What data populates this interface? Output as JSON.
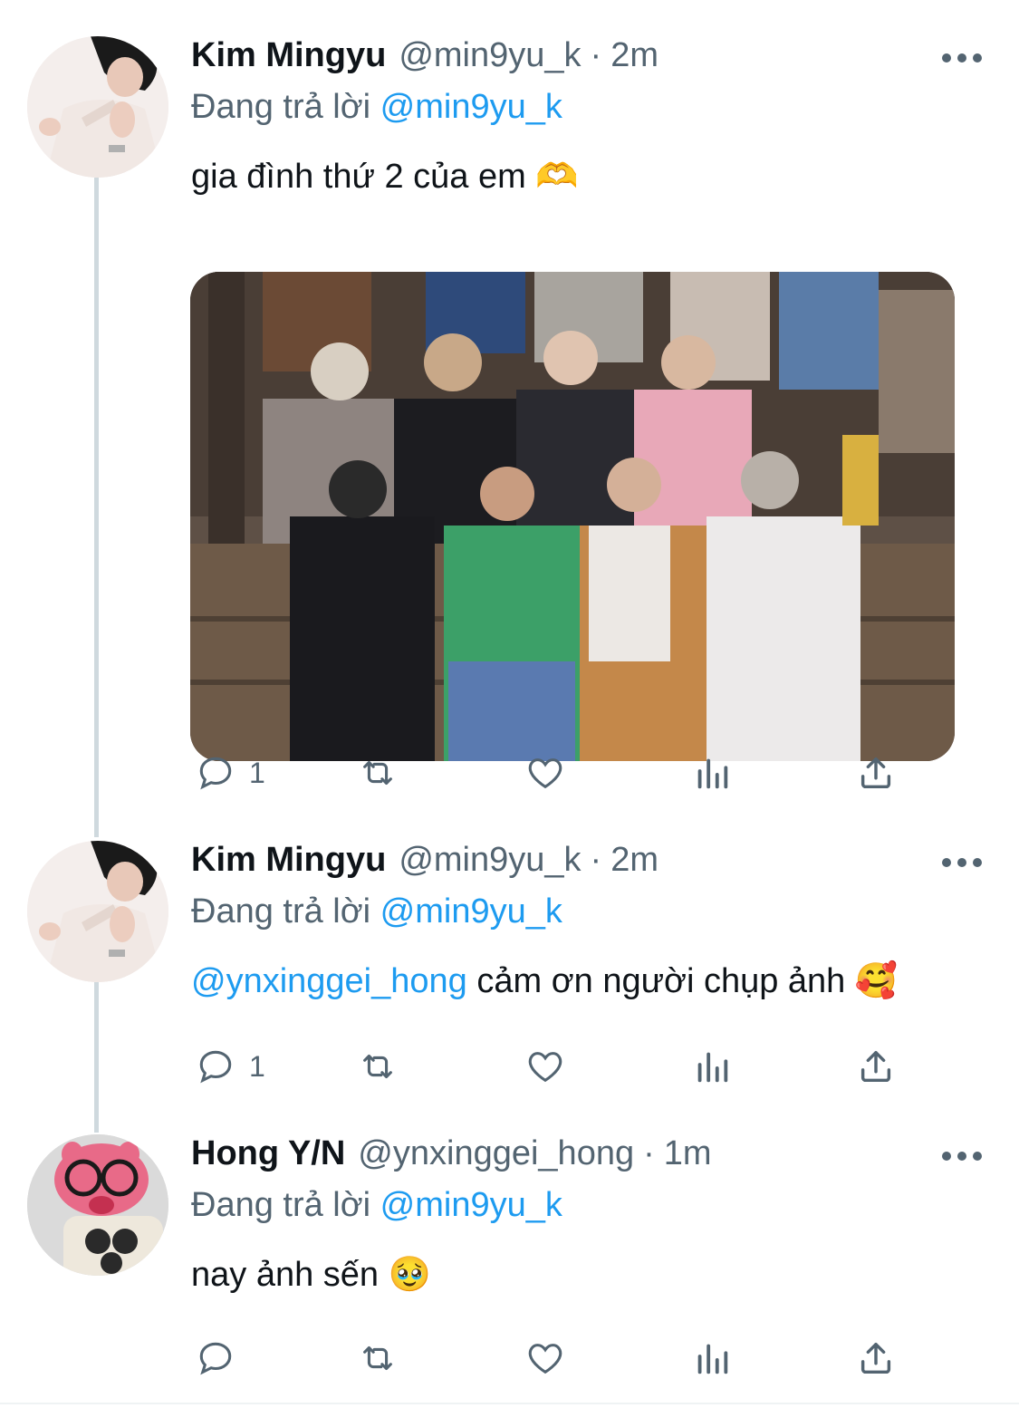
{
  "tweets": [
    {
      "name": "Kim Mingyu",
      "handle": "@min9yu_k",
      "separator": "·",
      "time": "2m",
      "reply_prefix": "Đang trả lời",
      "reply_handle": "@min9yu_k",
      "text": "gia đình thứ 2 của em 🫶",
      "reply_count": "1",
      "avatar": "profile-photo-person"
    },
    {
      "name": "Kim Mingyu",
      "handle": "@min9yu_k",
      "separator": "·",
      "time": "2m",
      "reply_prefix": "Đang trả lời",
      "reply_handle": "@min9yu_k",
      "text_mention": "@ynxinggei_hong",
      "text": " cảm ơn người chụp ảnh 🥰",
      "reply_count": "1",
      "avatar": "profile-photo-person"
    },
    {
      "name": "Hong Y/N",
      "handle": "@ynxinggei_hong",
      "separator": "·",
      "time": "1m",
      "reply_prefix": "Đang trả lời",
      "reply_handle": "@min9yu_k",
      "text": "nay ảnh sến 🥹",
      "reply_count": "",
      "avatar": "pink-plush-with-glasses"
    }
  ],
  "icons": [
    "reply-icon",
    "retweet-icon",
    "like-icon",
    "views-icon",
    "share-icon",
    "more-icon"
  ],
  "colors": {
    "accent": "#1d9bf0",
    "secondary_text": "#536471",
    "thread_line": "#cfd9de"
  }
}
